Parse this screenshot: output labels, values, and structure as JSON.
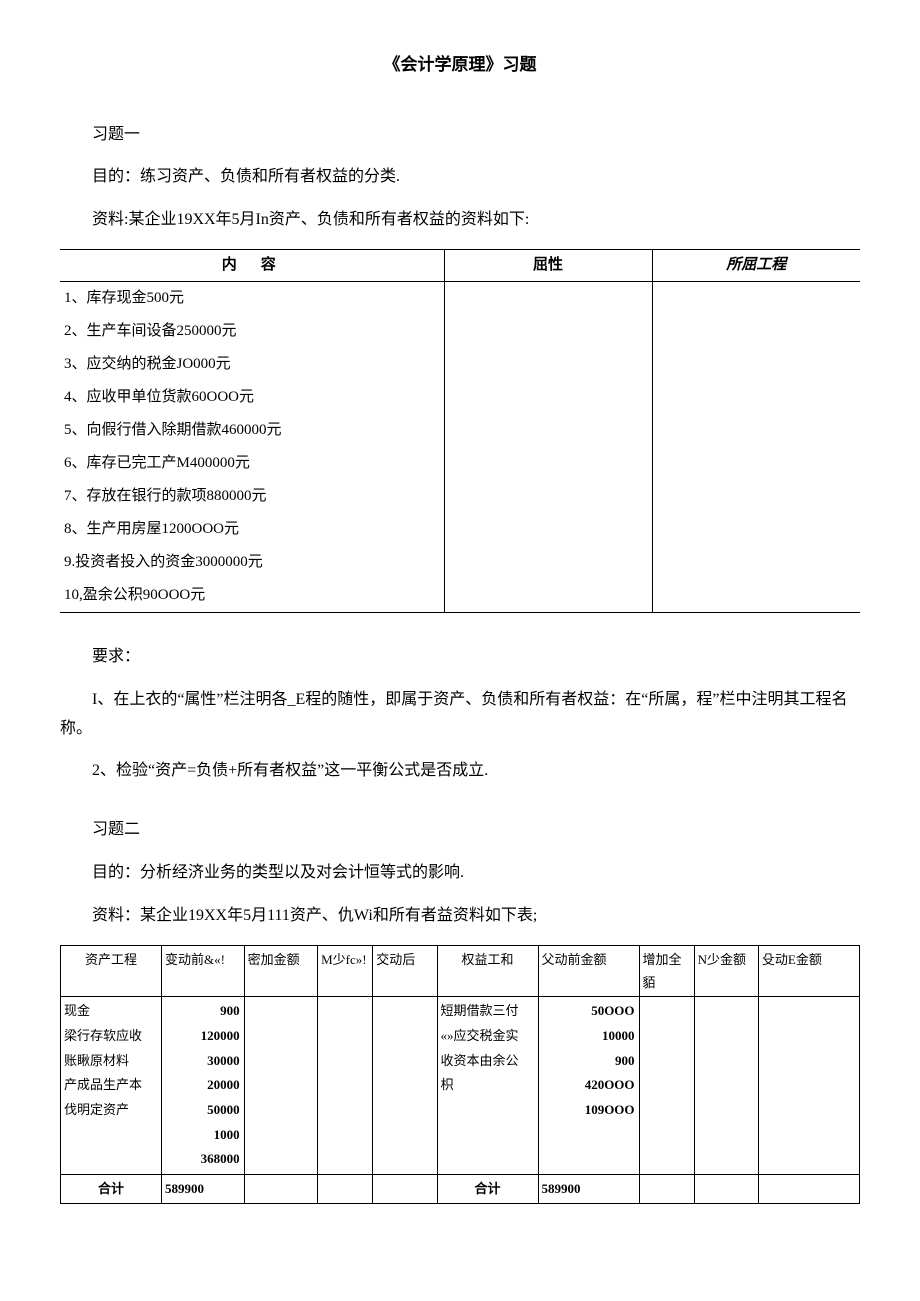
{
  "title": "《会计学原理》习题",
  "ex1": {
    "heading": "习题一",
    "purpose": "目的：练习资产、负债和所有者权益的分类.",
    "material": "资料:某企业19XX年5月In资产、负债和所有者权益的资料如下:",
    "headers": {
      "content": "内容",
      "attr": "屈性",
      "proj": "所屈工程"
    },
    "rows": [
      "1、库存现金500元",
      "2、生产车间设备250000元",
      "3、应交纳的税金JO000元",
      "4、应收甲单位货款60OOO元",
      "5、向假行借入除期借款460000元",
      "6、库存已完工产M400000元",
      "7、存放在银行的款项880000元",
      "8、生产用房屋1200OOO元",
      "9.投资者投入的资金3000000元",
      "10,盈余公积90OOO元"
    ],
    "req_label": "要求：",
    "req1": "I、在上衣的“属性”栏注明各_E程的随性，即属于资产、负债和所有者权益：在“所属，程”栏中注明其工程名称。",
    "req2": "2、检验“资产=负债+所有者权益”这一平衡公式是否成立."
  },
  "ex2": {
    "heading": "习题二",
    "purpose": "目的：分析经济业务的类型以及对会计恒等式的影响.",
    "material": "资料：某企业19XX年5月111资产、仇Wi和所有者益资料如下表;",
    "headers": {
      "asset_item": "资产工程",
      "before_a": "变动前&«!",
      "inc_a": "密加金额",
      "dec_a": "M少fc»!",
      "after_a": "交动后",
      "equity_item": "权益工和",
      "before_e": "父动前金额",
      "inc_e": "增加全貊",
      "dec_e": "N少金额",
      "after_e": "殳动E金额"
    },
    "assets_labels": "现金\n梁行存软应收\n账瞅原材料\n产成品生产本\n伐明定资产",
    "assets_values": "900\n120000\n30000\n20000\n50000\n1000\n368000",
    "equity_labels": "短期借款三付\n«»应交税金实\n收资本由余公\n枳",
    "equity_values": "50OOO\n10000\n900\n420OOO\n109OOO",
    "total_label": "合计",
    "total_assets": "589900",
    "total_equity": "589900"
  }
}
